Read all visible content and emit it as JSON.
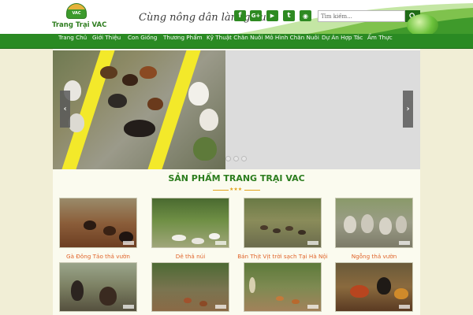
{
  "header": {
    "logo_alt": "VAC",
    "logo_text": "Trang Trại VAC",
    "slogan": "Cùng nông dân làm giàu!",
    "social": [
      {
        "name": "facebook-icon",
        "glyph": "f"
      },
      {
        "name": "google-plus-icon",
        "glyph": "G+"
      },
      {
        "name": "youtube-icon",
        "glyph": "▶"
      },
      {
        "name": "twitter-icon",
        "glyph": "t"
      },
      {
        "name": "rss-icon",
        "glyph": "◉"
      }
    ],
    "search_placeholder": "Tìm kiếm...",
    "search_icon": "search-icon"
  },
  "nav": {
    "items": [
      {
        "label": "Trang Chủ"
      },
      {
        "label": "Giới Thiệu"
      },
      {
        "label": "Con Giống"
      },
      {
        "label": "Thương Phẩm"
      },
      {
        "label": "Kỹ Thuật Chăn Nuôi"
      },
      {
        "label": "Mô Hình Chăn Nuôi"
      },
      {
        "label": "Dự Án Hợp Tác"
      },
      {
        "label": "Ẩm Thực"
      }
    ]
  },
  "slider": {
    "prev_glyph": "‹",
    "next_glyph": "›",
    "dot_count": 3
  },
  "products": {
    "title": "SẢN PHẨM TRANG TRẠI VAC",
    "ornament": "★★★",
    "items": [
      {
        "name": "Gà Đông Tảo thả vườn"
      },
      {
        "name": "Dê thả núi"
      },
      {
        "name": "Bán Thịt Vịt trời sạch Tại Hà Nội"
      },
      {
        "name": "Ngỗng thả vườn"
      }
    ]
  },
  "colors": {
    "brand_green": "#2a8a23",
    "accent_orange": "#e0642a",
    "stripe_yellow": "#f3e92a"
  }
}
